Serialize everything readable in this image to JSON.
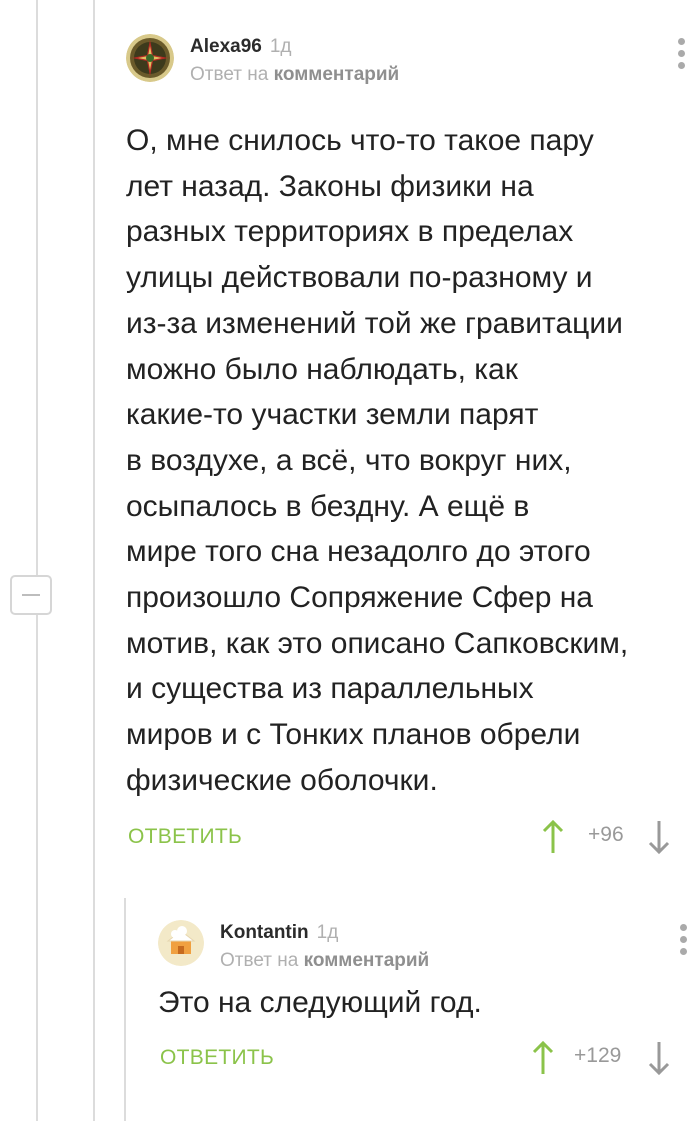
{
  "comments": [
    {
      "author": "Alexa96",
      "time": "1д",
      "reply_prefix": "Ответ на",
      "reply_target": "комментарий",
      "text_lines": [
        "О, мне снилось что-то такое пару",
        "лет назад. Законы физики на",
        "разных территориях в пределах",
        "улицы действовали по-разному и",
        "из-за изменений той же гравитации",
        "можно было наблюдать, как",
        "какие-то участки земли парят",
        "в воздухе, а всё, что вокруг них,",
        "осыпалось в бездну. А ещё в",
        "мире того сна незадолго до этого",
        "произошло Сопряжение Сфер на",
        "мотив, как это описано Сапковским,",
        "и существа из параллельных",
        "миров и с Тонких планов обрели",
        "физические оболочки."
      ],
      "reply_label": "ОТВЕТИТЬ",
      "rating": "+96"
    },
    {
      "author": "Kontantin",
      "time": "1д",
      "reply_prefix": "Ответ на",
      "reply_target": "комментарий",
      "text_lines": [
        "Это на следующий год."
      ],
      "reply_label": "ОТВЕТИТЬ",
      "rating": "+129"
    }
  ],
  "colors": {
    "accent_green": "#8bc34a",
    "muted_gray": "#b0b0b0",
    "tree_line": "#dcdcdc"
  },
  "icons": [
    "more-vertical-icon",
    "upvote-arrow-icon",
    "downvote-arrow-icon",
    "collapse-minus-icon"
  ]
}
